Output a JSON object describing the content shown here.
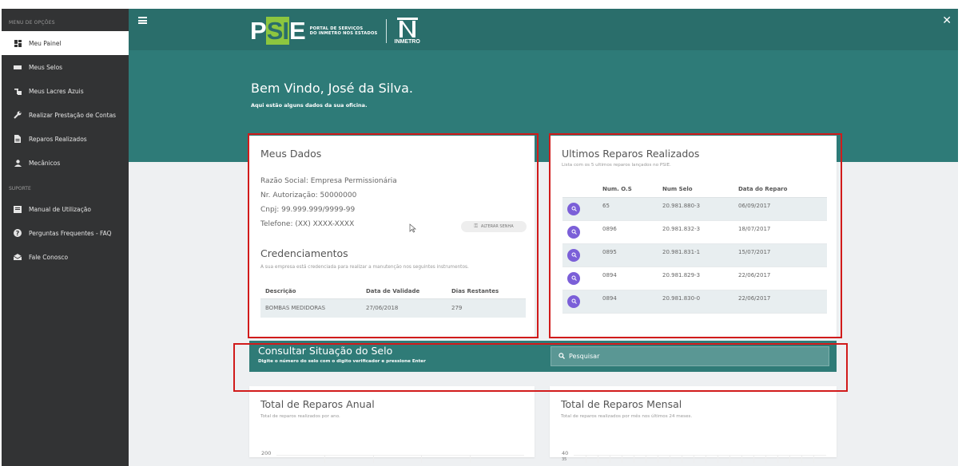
{
  "sidebar": {
    "menu_heading": "MENU DE OPÇÕES",
    "items": [
      {
        "label": "Meu Painel",
        "icon": "dashboard-icon",
        "active": true
      },
      {
        "label": "Meus Selos",
        "icon": "seal-icon"
      },
      {
        "label": "Meus Lacres Azuis",
        "icon": "padlock-icon"
      },
      {
        "label": "Realizar Prestação de Contas",
        "icon": "wrench-icon"
      },
      {
        "label": "Reparos Realizados",
        "icon": "document-icon"
      },
      {
        "label": "Mecânicos",
        "icon": "person-icon"
      }
    ],
    "support_heading": "SUPORTE",
    "support_items": [
      {
        "label": "Manual de Utilização",
        "icon": "book-icon"
      },
      {
        "label": "Perguntas Frequentes - FAQ",
        "icon": "question-icon"
      },
      {
        "label": "Fale Conosco",
        "icon": "mail-icon"
      }
    ]
  },
  "header": {
    "logo_text": "PSIE",
    "logo_sub_line1": "PORTAL DE SERVIÇOS",
    "logo_sub_line2": "DO INMETRO NOS ESTADOS",
    "inmetro_text": "INMETRO"
  },
  "hero": {
    "welcome": "Bem Vindo, José da Silva.",
    "subtitle": "Aqui estão alguns dados da sua oficina."
  },
  "meus_dados": {
    "title": "Meus Dados",
    "razao_social": "Razão Social: Empresa Permissionária",
    "autorizacao": "Nr. Autorização: 50000000",
    "cnpj": "Cnpj: 99.999.999/9999-99",
    "telefone": "Telefone: (XX) XXXX-XXXX",
    "alterar_senha": "ALTERAR SENHA",
    "cred_title": "Credenciamentos",
    "cred_sub": "A sua empresa está credenciada para realizar a manutenção nos seguintes instrumentos.",
    "cred_headers": [
      "Descrição",
      "Data de Validade",
      "Dias Restantes"
    ],
    "cred_rows": [
      [
        "BOMBAS MEDIDORAS",
        "27/06/2018",
        "279"
      ]
    ]
  },
  "ultimos_reparos": {
    "title": "Ultimos Reparos Realizados",
    "subtitle": "Lista com os 5 ultimos reparos lançados no PSIE.",
    "headers": [
      "Num. O.S",
      "Num Selo",
      "Data do Reparo"
    ],
    "rows": [
      [
        "65",
        "20.981.880-3",
        "06/09/2017"
      ],
      [
        "0896",
        "20.981.832-3",
        "18/07/2017"
      ],
      [
        "0895",
        "20.981.831-1",
        "15/07/2017"
      ],
      [
        "0894",
        "20.981.829-3",
        "22/06/2017"
      ],
      [
        "0894",
        "20.981.830-0",
        "22/06/2017"
      ]
    ]
  },
  "consultar": {
    "title": "Consultar Situação do Selo",
    "subtitle": "Digite o número do selo com o digito verificador e pressione Enter",
    "placeholder": "Pesquisar"
  },
  "chart_anual": {
    "title": "Total de Reparos Anual",
    "subtitle": "Total de reparos realizados por ano.",
    "y_top": "200"
  },
  "chart_mensal": {
    "title": "Total de Reparos Mensal",
    "subtitle": "Total de reparos realizados por mês nos últimos 24 meses.",
    "y_top": "40",
    "y_next": "35"
  },
  "colors": {
    "header_teal": "#2a6e6b",
    "hero_teal": "#2e7b78",
    "sidebar_bg": "#323334",
    "accent_purple": "#7b5fd8",
    "annotation_red": "#d11b1b"
  }
}
